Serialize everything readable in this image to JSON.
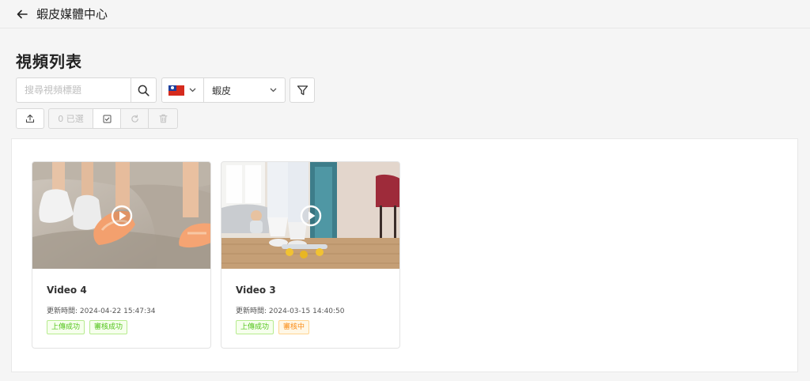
{
  "header": {
    "title": "蝦皮媒體中心"
  },
  "page": {
    "title": "視頻列表"
  },
  "search": {
    "placeholder": "搜尋視頻標題",
    "value": ""
  },
  "region": {
    "flag": "taiwan-flag-icon"
  },
  "shop": {
    "value": "蝦皮"
  },
  "toolbar": {
    "selected_count": "0 已選"
  },
  "update_label": "更新時間:",
  "videos": [
    {
      "title": "Video 4",
      "updated": "2024-04-22 15:47:34",
      "tags": [
        {
          "label": "上傳成功",
          "color": "#52c41a"
        },
        {
          "label": "審核成功",
          "color": "#52c41a"
        }
      ]
    },
    {
      "title": "Video 3",
      "updated": "2024-03-15 14:40:50",
      "tags": [
        {
          "label": "上傳成功",
          "color": "#52c41a"
        },
        {
          "label": "審核中",
          "color": "#fa8c16"
        }
      ]
    }
  ]
}
